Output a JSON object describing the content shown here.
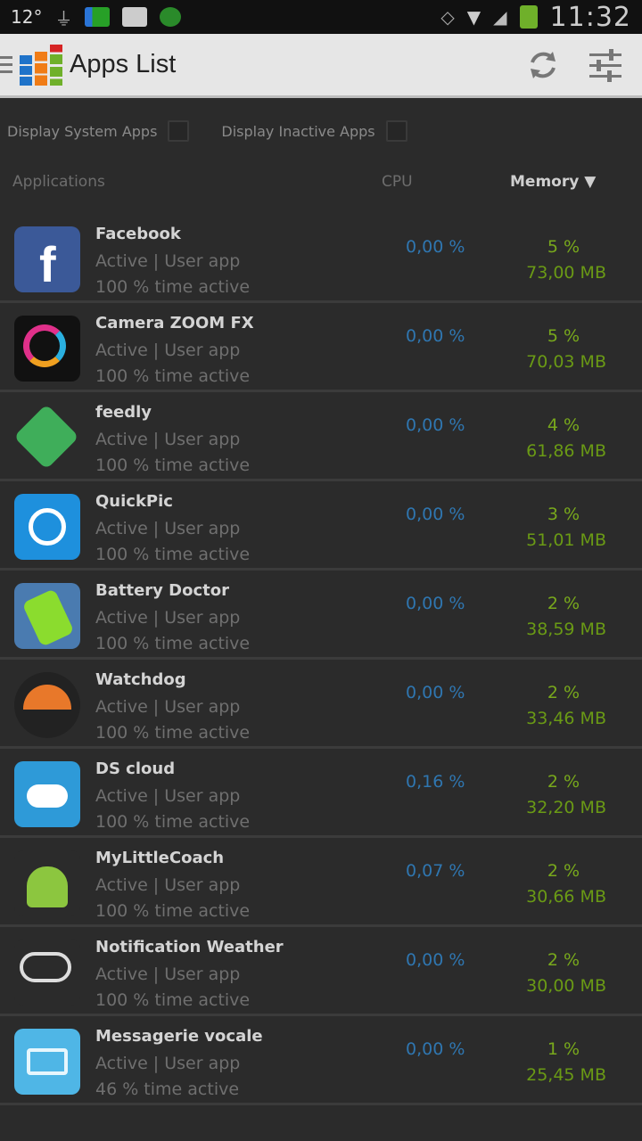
{
  "status_bar": {
    "left_text": "12°",
    "time": "11:32"
  },
  "action_bar": {
    "title": "Apps List"
  },
  "filters": {
    "system_apps": "Display System Apps",
    "inactive_apps": "Display Inactive Apps"
  },
  "columns": {
    "applications": "Applications",
    "cpu": "CPU",
    "memory": "Memory ▼"
  },
  "apps": [
    {
      "name": "Facebook",
      "status": "Active | User app",
      "active": "100 % time active",
      "cpu": "0,00 %",
      "mem_pct": "5 %",
      "mem_mb": "73,00 MB",
      "icon": "facebook-icon",
      "color": "#3b5998"
    },
    {
      "name": "Camera ZOOM FX",
      "status": "Active | User app",
      "active": "100 % time active",
      "cpu": "0,00 %",
      "mem_pct": "5 %",
      "mem_mb": "70,03 MB",
      "icon": "camera-zoom-fx-icon",
      "color": "#111111"
    },
    {
      "name": "feedly",
      "status": "Active | User app",
      "active": "100 % time active",
      "cpu": "0,00 %",
      "mem_pct": "4 %",
      "mem_mb": "61,86 MB",
      "icon": "feedly-icon",
      "color": "#3fae5a"
    },
    {
      "name": "QuickPic",
      "status": "Active | User app",
      "active": "100 % time active",
      "cpu": "0,00 %",
      "mem_pct": "3 %",
      "mem_mb": "51,01 MB",
      "icon": "quickpic-icon",
      "color": "#1e90dd"
    },
    {
      "name": "Battery Doctor",
      "status": "Active | User app",
      "active": "100 % time active",
      "cpu": "0,00 %",
      "mem_pct": "2 %",
      "mem_mb": "38,59 MB",
      "icon": "battery-doctor-icon",
      "color": "#4a7bb0"
    },
    {
      "name": "Watchdog",
      "status": "Active | User app",
      "active": "100 % time active",
      "cpu": "0,00 %",
      "mem_pct": "2 %",
      "mem_mb": "33,46 MB",
      "icon": "watchdog-icon",
      "color": "#222222"
    },
    {
      "name": "DS cloud",
      "status": "Active | User app",
      "active": "100 % time active",
      "cpu": "0,16 %",
      "mem_pct": "2 %",
      "mem_mb": "32,20 MB",
      "icon": "ds-cloud-icon",
      "color": "#2e9ad8"
    },
    {
      "name": "MyLittleCoach",
      "status": "Active | User app",
      "active": "100 % time active",
      "cpu": "0,07 %",
      "mem_pct": "2 %",
      "mem_mb": "30,66 MB",
      "icon": "android-robot-icon",
      "color": "#2b2b2b"
    },
    {
      "name": "Notification Weather",
      "status": "Active | User app",
      "active": "100 % time active",
      "cpu": "0,00 %",
      "mem_pct": "2 %",
      "mem_mb": "30,00 MB",
      "icon": "weather-cloud-icon",
      "color": "#2b2b2b"
    },
    {
      "name": "Messagerie vocale",
      "status": "Active | User app",
      "active": "46 % time active",
      "cpu": "0,00 %",
      "mem_pct": "1 %",
      "mem_mb": "25,45 MB",
      "icon": "voicemail-icon",
      "color": "#4fb6e6"
    }
  ]
}
